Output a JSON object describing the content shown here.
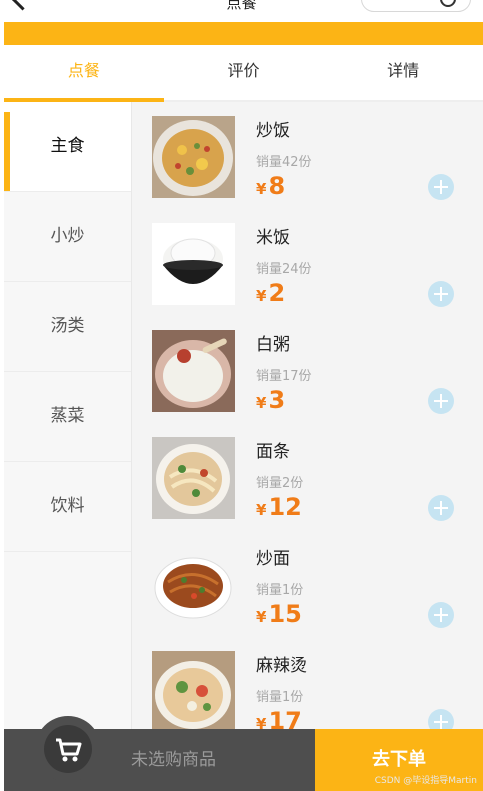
{
  "header": {
    "title": "点餐"
  },
  "tabs": [
    {
      "label": "点餐",
      "active": true
    },
    {
      "label": "评价",
      "active": false
    },
    {
      "label": "详情",
      "active": false
    }
  ],
  "categories": [
    {
      "label": "主食",
      "active": true
    },
    {
      "label": "小炒",
      "active": false
    },
    {
      "label": "汤类",
      "active": false
    },
    {
      "label": "蒸菜",
      "active": false
    },
    {
      "label": "饮料",
      "active": false
    }
  ],
  "items": [
    {
      "name": "炒饭",
      "sales": "销量42份",
      "currency": "¥",
      "price": "8",
      "image_icon": "fried-rice-image"
    },
    {
      "name": "米饭",
      "sales": "销量24份",
      "currency": "¥",
      "price": "2",
      "image_icon": "rice-bowl-image"
    },
    {
      "name": "白粥",
      "sales": "销量17份",
      "currency": "¥",
      "price": "3",
      "image_icon": "congee-image"
    },
    {
      "name": "面条",
      "sales": "销量2份",
      "currency": "¥",
      "price": "12",
      "image_icon": "noodle-soup-image"
    },
    {
      "name": "炒面",
      "sales": "销量1份",
      "currency": "¥",
      "price": "15",
      "image_icon": "fried-noodles-image"
    },
    {
      "name": "麻辣烫",
      "sales": "销量1份",
      "currency": "¥",
      "price": "17",
      "image_icon": "malatang-image"
    }
  ],
  "cart": {
    "empty_text": "未选购商品",
    "checkout_label": "去下单"
  },
  "watermark": "CSDN @毕设指导Martin",
  "colors": {
    "accent": "#fcb415",
    "price": "#f07c18",
    "add_button": "#c6e4f2",
    "cart_bar": "#4e4e4e"
  }
}
